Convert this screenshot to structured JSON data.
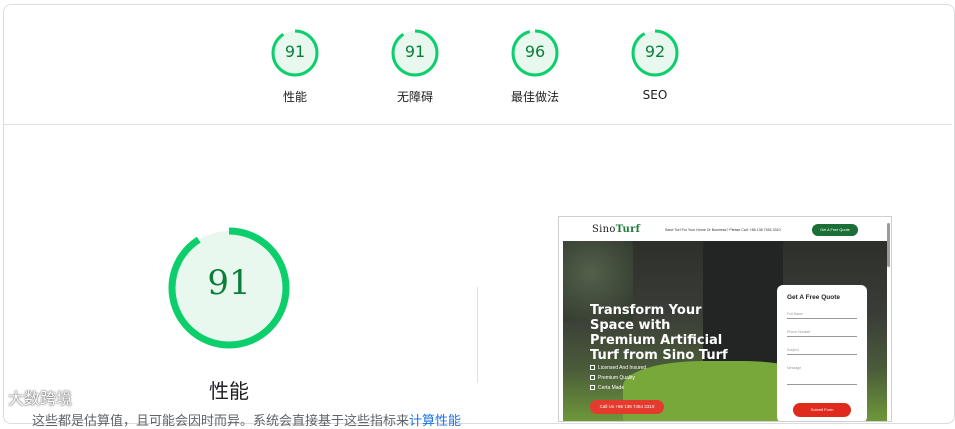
{
  "summary_scores": [
    {
      "label": "性能",
      "score": "91",
      "value": 91
    },
    {
      "label": "无障碍",
      "score": "91",
      "value": 91
    },
    {
      "label": "最佳做法",
      "score": "96",
      "value": 96
    },
    {
      "label": "SEO",
      "score": "92",
      "value": 92
    }
  ],
  "main_score": {
    "label": "性能",
    "score": "91",
    "value": 91
  },
  "note": {
    "text": "这些都是估算值，且可能会因时而异。系统会直接基于这些指标来",
    "link": "计算性能"
  },
  "watermark": "大数跨境",
  "colors": {
    "pass": "#0cce6b",
    "pass_fill": "#e8f8ee",
    "pass_text": "#0b7f3a"
  },
  "screenshot": {
    "logo_plain": "Sino",
    "logo_brand": "Turf",
    "nav_text": "Sand Turf For Your Home Or Business? Please Call: +86 138 7454 3310",
    "nav_button": "Get A Free Quote",
    "hero_title": "Transform Your Space with Premium Artificial Turf from Sino Turf",
    "features": [
      "Licensed And Insured",
      "Premium Quality",
      "Certa Made"
    ],
    "cta": "Call Us +86 138 7454 3310",
    "form_title": "Get A Free Quote",
    "form_fields": [
      "Full Name",
      "Phone Number",
      "Subject",
      "Message"
    ],
    "form_button": "Submit Form"
  }
}
